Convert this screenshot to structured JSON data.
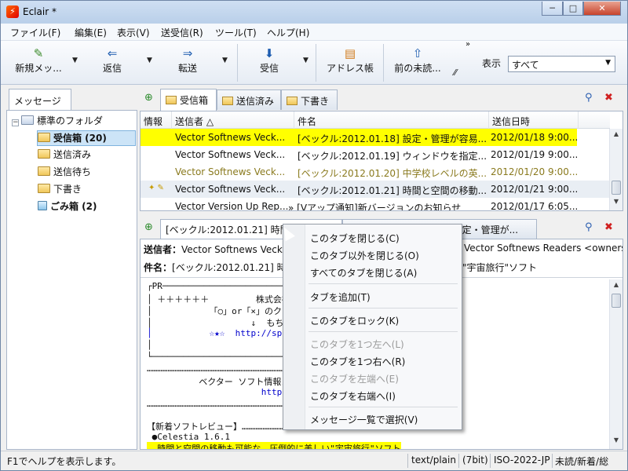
{
  "window": {
    "title": "Eclair *",
    "app_icon": "eclair-icon",
    "controls": [
      "─",
      "□",
      "✕"
    ]
  },
  "menu": [
    "ファイル(F)",
    "編集(E)",
    "表示(V)",
    "送受信(R)",
    "ツール(T)",
    "ヘルプ(H)"
  ],
  "toolbar": {
    "buttons": [
      {
        "label": "新規メッ...",
        "icon": "pencil-icon"
      },
      {
        "label": "返信",
        "icon": "reply-icon"
      },
      {
        "label": "転送",
        "icon": "forward-icon"
      },
      {
        "label": "受信",
        "icon": "receive-icon"
      },
      {
        "label": "アドレス帳",
        "icon": "address-book-icon"
      },
      {
        "label": "前の未読...",
        "icon": "prev-unread-icon"
      }
    ],
    "overflow": "»",
    "more": "⁄⁄",
    "view_label": "表示",
    "view_value": "すべて"
  },
  "left_panel": {
    "tab": "メッセージ",
    "tree": [
      {
        "label": "標準のフォルダ",
        "kind": "root"
      },
      {
        "label": "受信箱 (20)",
        "kind": "inbox",
        "bold": true,
        "selected": true
      },
      {
        "label": "送信済み",
        "kind": "folder"
      },
      {
        "label": "送信待ち",
        "kind": "folder"
      },
      {
        "label": "下書き",
        "kind": "folder"
      },
      {
        "label": "ごみ箱 (2)",
        "kind": "trash",
        "bold": true
      }
    ]
  },
  "folder_tabs": [
    "受信箱",
    "送信済み",
    "下書き"
  ],
  "message_list": {
    "columns": [
      "情報",
      "送信者 △",
      "件名",
      "送信日時"
    ],
    "rows": [
      {
        "info": "",
        "sender": "Vector Softnews Veck...",
        "subject": "[ベックル:2012.01.18] 設定・管理が容易...",
        "date": "2012/01/18 9:00..."
      },
      {
        "info": "",
        "sender": "Vector Softnews Veck...",
        "subject": "[ベックル:2012.01.19] ウィンドウを指定...",
        "date": "2012/01/19 9:00..."
      },
      {
        "info": "",
        "sender": "Vector Softnews Veck...",
        "subject": "[ベックル:2012.01.20] 中学校レベルの英...",
        "date": "2012/01/20 9:00..."
      },
      {
        "info": "✦ ✎",
        "sender": "Vector Softnews Veck...",
        "subject": "[ベックル:2012.01.21] 時間と空間の移動...",
        "date": "2012/01/21 9:00..."
      },
      {
        "info": "",
        "sender": "Vector Version Up Rep...",
        "subject": "» [Vアップ通知]新バージョンのお知らせ",
        "date": "2012/01/17 6:05..."
      }
    ]
  },
  "preview_tabs": [
    "[ベックル:2012.01.21] 時間と空間の...",
    "[ベックル:2012.01.18] 設定・管理が..."
  ],
  "preview": {
    "from_label": "送信者：",
    "from_value": "Vector Softnews Veck",
    "from_tail": "Vector Softnews Readers <owners",
    "subject_label": "件名：",
    "subject_value": "[ベックル:2012.01.21] 時",
    "subject_tail": "\"宇宙旅行\"ソフト",
    "body_lines": [
      "┌PR─────────────────────────────────────",
      "│ ＋＋＋＋＋＋         株式会社YU",
      "│           「○」or「×」のクイズ",
      "│                   ↓  もち",
      "│           ☆★☆  http://spj.c",
      "│                           △",
      "└─────────────────────────────────PR─",
      "………………………………………………………………………………………………………………………………",
      "          ベクター ソフト情報メ",
      "                      http",
      "………………………………………………………………………………………………………………………………",
      "",
      "【新着ソフトレビュー】…………………………………………………………",
      " ●Celestia 1.6.1",
      "  時間と空間の移動も可能な、圧倒的に美しい\"宇宙旅行\"ソフト"
    ]
  },
  "context_menu": {
    "items": [
      {
        "label": "このタブを閉じる(C)",
        "enabled": true
      },
      {
        "label": "このタブ以外を閉じる(O)",
        "enabled": true
      },
      {
        "label": "すべてのタブを閉じる(A)",
        "enabled": true
      },
      {
        "label": "タブを追加(T)",
        "enabled": true
      },
      {
        "label": "このタブをロック(K)",
        "enabled": true
      },
      {
        "label": "このタブを1つ左へ(L)",
        "enabled": false
      },
      {
        "label": "このタブを1つ右へ(R)",
        "enabled": true
      },
      {
        "label": "このタブを左端へ(E)",
        "enabled": false
      },
      {
        "label": "このタブを右端へ(I)",
        "enabled": true
      },
      {
        "label": "メッセージ一覧で選択(V)",
        "enabled": true
      }
    ]
  },
  "status": {
    "help": "F1でヘルプを表示します。",
    "content_type": "text/plain",
    "bits": "(7bit)",
    "charset": "ISO-2022-JP",
    "counts": "未読/新着/総"
  },
  "colors": {
    "highlight": "#ffff00",
    "link": "#0000cc",
    "dimmed_row": "#8a7a1e",
    "accent": "#2a5db0"
  }
}
